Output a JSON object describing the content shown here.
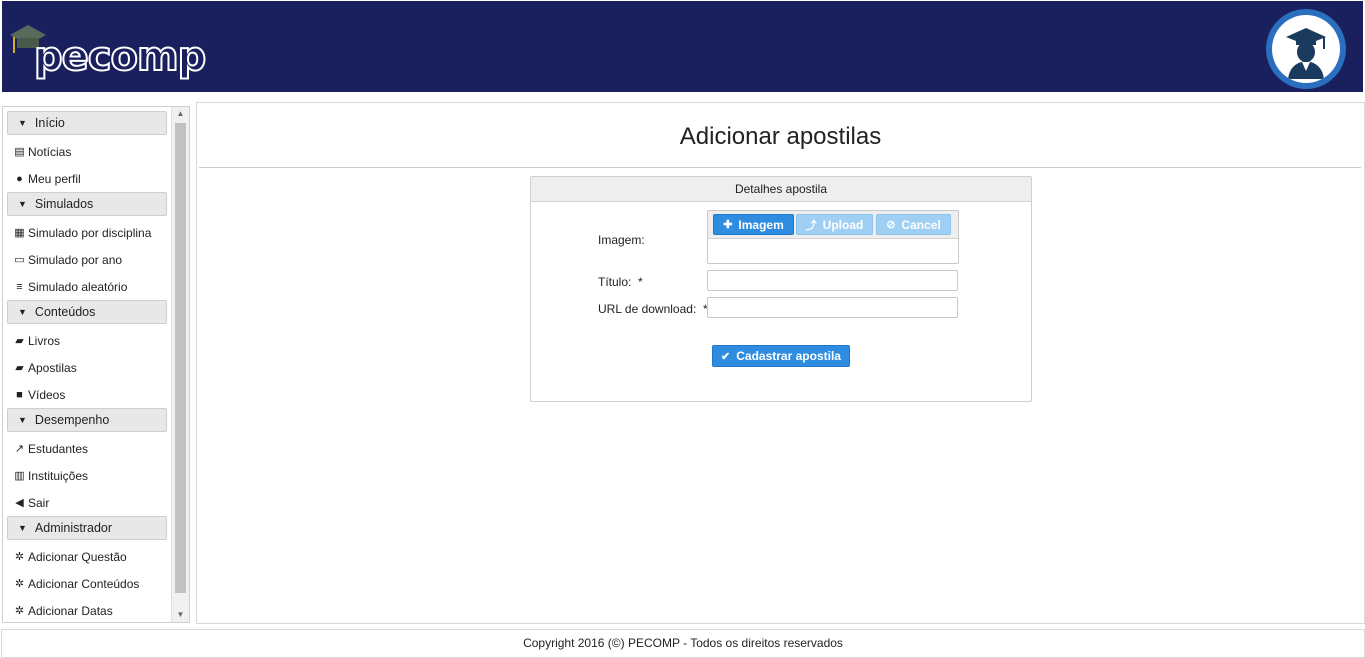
{
  "header": {
    "logo_text": "pecomp",
    "avatar_icon": "graduate-avatar-icon"
  },
  "sidebar": {
    "sections": [
      {
        "title": "Início",
        "items": [
          {
            "label": "Notícias",
            "icon": "newspaper-icon"
          },
          {
            "label": "Meu perfil",
            "icon": "user-icon"
          }
        ]
      },
      {
        "title": "Simulados",
        "items": [
          {
            "label": "Simulado por disciplina",
            "icon": "table-icon"
          },
          {
            "label": "Simulado por ano",
            "icon": "calendar-icon"
          },
          {
            "label": "Simulado aleatório",
            "icon": "list-icon"
          }
        ]
      },
      {
        "title": "Conteúdos",
        "items": [
          {
            "label": "Livros",
            "icon": "book-icon"
          },
          {
            "label": "Apostilas",
            "icon": "book-icon"
          },
          {
            "label": "Vídeos",
            "icon": "video-icon"
          }
        ]
      },
      {
        "title": "Desempenho",
        "items": [
          {
            "label": "Estudantes",
            "icon": "line-chart-icon"
          },
          {
            "label": "Instituições",
            "icon": "bar-chart-icon"
          },
          {
            "label": "Sair",
            "icon": "back-circle-icon"
          }
        ]
      },
      {
        "title": "Administrador",
        "items": [
          {
            "label": "Adicionar Questão",
            "icon": "gear-icon"
          },
          {
            "label": "Adicionar Conteúdos",
            "icon": "gear-icon"
          },
          {
            "label": "Adicionar Datas",
            "icon": "gear-icon"
          }
        ]
      }
    ]
  },
  "main": {
    "title": "Adicionar apostilas",
    "panel": {
      "title": "Detalhes apostila",
      "image_label": "Imagem:",
      "upload_buttons": {
        "add": "Imagem",
        "upload": "Upload",
        "cancel": "Cancel"
      },
      "title_label": "Título:",
      "url_label": "URL de download:",
      "required_mark": "*",
      "title_value": "",
      "url_value": "",
      "submit_label": "Cadastrar apostila"
    }
  },
  "footer": {
    "text": "Copyright 2016 (©) PECOMP - Todos os direitos reservados"
  },
  "colors": {
    "header_bg": "#1a1f5e",
    "primary": "#2e8de0",
    "disabled": "#9fd0f3"
  }
}
